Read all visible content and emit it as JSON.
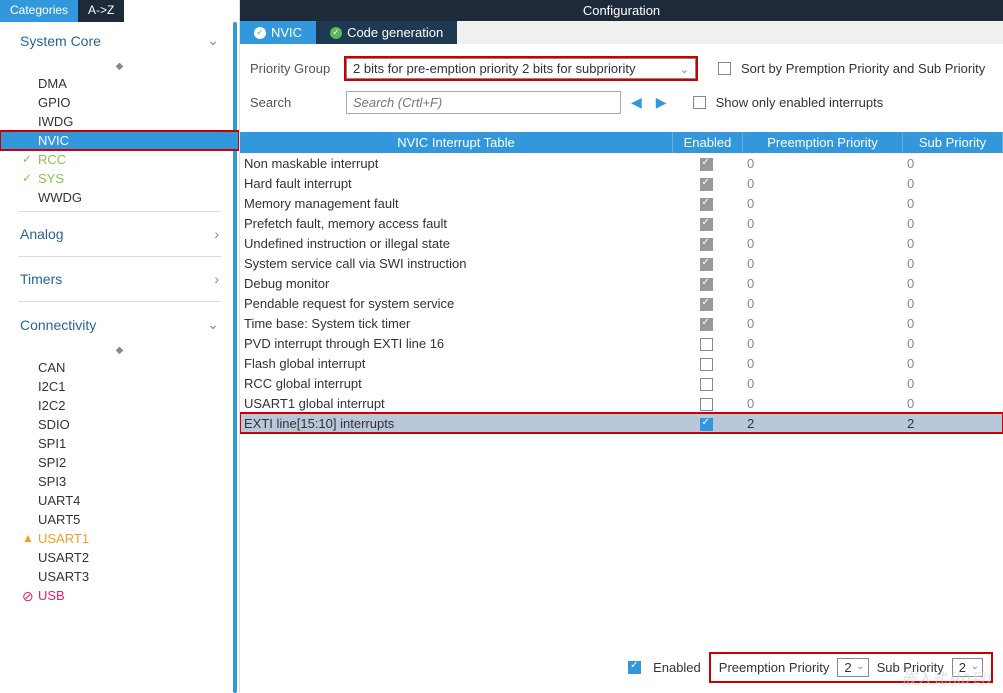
{
  "leftTabs": {
    "categories": "Categories",
    "az": "A->Z"
  },
  "groups": {
    "systemCore": "System Core",
    "analog": "Analog",
    "timers": "Timers",
    "connectivity": "Connectivity"
  },
  "systemCoreItems": [
    "DMA",
    "GPIO",
    "IWDG",
    "NVIC",
    "RCC",
    "SYS",
    "WWDG"
  ],
  "connectivityItems": [
    "CAN",
    "I2C1",
    "I2C2",
    "SDIO",
    "SPI1",
    "SPI2",
    "SPI3",
    "UART4",
    "UART5",
    "USART1",
    "USART2",
    "USART3",
    "USB"
  ],
  "configTitle": "Configuration",
  "subTabs": {
    "nvic": "NVIC",
    "codeGen": "Code generation"
  },
  "controls": {
    "priorityGroupLabel": "Priority Group",
    "priorityGroupValue": "2 bits for pre-emption priority 2 bits for subpriority",
    "sortLabel": "Sort by Premption Priority and Sub Priority",
    "searchLabel": "Search",
    "searchPlaceholder": "Search (Crtl+F)",
    "showOnlyLabel": "Show only enabled interrupts"
  },
  "tableHeaders": {
    "c1": "NVIC Interrupt Table",
    "c2": "Enabled",
    "c3": "Preemption Priority",
    "c4": "Sub Priority"
  },
  "rows": [
    {
      "name": "Non maskable interrupt",
      "enabled": true,
      "locked": true,
      "pp": "0",
      "sp": "0"
    },
    {
      "name": "Hard fault interrupt",
      "enabled": true,
      "locked": true,
      "pp": "0",
      "sp": "0"
    },
    {
      "name": "Memory management fault",
      "enabled": true,
      "locked": true,
      "pp": "0",
      "sp": "0"
    },
    {
      "name": "Prefetch fault, memory access fault",
      "enabled": true,
      "locked": true,
      "pp": "0",
      "sp": "0"
    },
    {
      "name": "Undefined instruction or illegal state",
      "enabled": true,
      "locked": true,
      "pp": "0",
      "sp": "0"
    },
    {
      "name": "System service call via SWI instruction",
      "enabled": true,
      "locked": true,
      "pp": "0",
      "sp": "0"
    },
    {
      "name": "Debug monitor",
      "enabled": true,
      "locked": true,
      "pp": "0",
      "sp": "0"
    },
    {
      "name": "Pendable request for system service",
      "enabled": true,
      "locked": true,
      "pp": "0",
      "sp": "0"
    },
    {
      "name": "Time base: System tick timer",
      "enabled": true,
      "locked": true,
      "pp": "0",
      "sp": "0"
    },
    {
      "name": "PVD interrupt through EXTI line 16",
      "enabled": false,
      "locked": false,
      "pp": "0",
      "sp": "0"
    },
    {
      "name": "Flash global interrupt",
      "enabled": false,
      "locked": false,
      "pp": "0",
      "sp": "0"
    },
    {
      "name": "RCC global interrupt",
      "enabled": false,
      "locked": false,
      "pp": "0",
      "sp": "0"
    },
    {
      "name": "USART1 global interrupt",
      "enabled": false,
      "locked": false,
      "pp": "0",
      "sp": "0"
    },
    {
      "name": "EXTI line[15:10] interrupts",
      "enabled": true,
      "locked": false,
      "pp": "2",
      "sp": "2",
      "highlighted": true
    }
  ],
  "bottom": {
    "enabledLabel": "Enabled",
    "ppLabel": "Preemption Priority",
    "ppValue": "2",
    "spLabel": "Sub Priority",
    "spValue": "2"
  },
  "watermark": "嵌入式从0到1"
}
